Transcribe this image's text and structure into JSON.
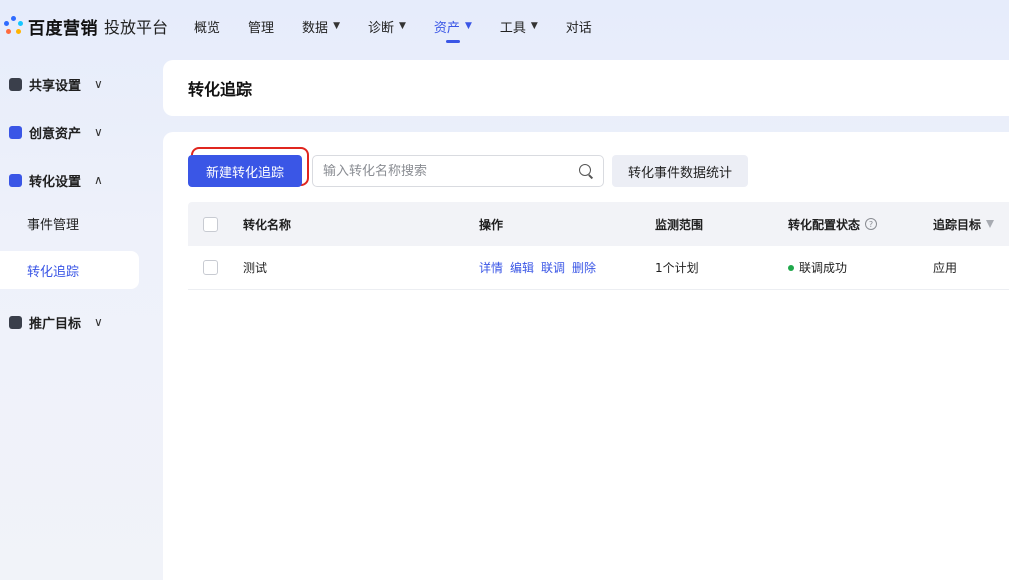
{
  "brand": {
    "name": "百度营销",
    "product": "投放平台",
    "dot_colors": [
      "#2f6bff",
      "#2f6bff",
      "#16c6ff",
      "#ff6b3d",
      "#ffb400"
    ]
  },
  "nav": {
    "items": [
      {
        "label": "概览",
        "has_caret": false,
        "active": false
      },
      {
        "label": "管理",
        "has_caret": false,
        "active": false
      },
      {
        "label": "数据",
        "has_caret": true,
        "active": false
      },
      {
        "label": "诊断",
        "has_caret": true,
        "active": false
      },
      {
        "label": "资产",
        "has_caret": true,
        "active": true
      },
      {
        "label": "工具",
        "has_caret": true,
        "active": false
      },
      {
        "label": "对话",
        "has_caret": false,
        "active": false
      }
    ],
    "caret_glyph": "▼"
  },
  "sidebar": {
    "groups": [
      {
        "label": "共享设置",
        "icon": "share-settings-icon",
        "icon_color": "#3a3f4b",
        "expanded": false
      },
      {
        "label": "创意资产",
        "icon": "creative-assets-icon",
        "icon_color": "#3a56e6",
        "expanded": false
      },
      {
        "label": "转化设置",
        "icon": "conversion-settings-icon",
        "icon_color": "#3a56e6",
        "expanded": true,
        "children": [
          {
            "label": "事件管理",
            "active": false
          },
          {
            "label": "转化追踪",
            "active": true
          }
        ]
      },
      {
        "label": "推广目标",
        "icon": "promotion-target-icon",
        "icon_color": "#3a3f4b",
        "expanded": false
      }
    ],
    "chevron_down": "∨",
    "chevron_up": "∧"
  },
  "page": {
    "title": "转化追踪"
  },
  "toolbar": {
    "new_button_label": "新建转化追踪",
    "search_placeholder": "输入转化名称搜索",
    "stats_button_label": "转化事件数据统计"
  },
  "table": {
    "headers": {
      "name": "转化名称",
      "operations": "操作",
      "scope": "监测范围",
      "status": "转化配置状态",
      "target": "追踪目标"
    },
    "help_glyph": "?",
    "rows": [
      {
        "name": "测试",
        "operations": [
          "详情",
          "编辑",
          "联调",
          "删除"
        ],
        "scope": "1个计划",
        "status": "联调成功",
        "status_color": "#1fa84b",
        "target": "应用"
      }
    ]
  },
  "colors": {
    "accent": "#3a56e6",
    "highlight_ring": "#e0261f"
  }
}
